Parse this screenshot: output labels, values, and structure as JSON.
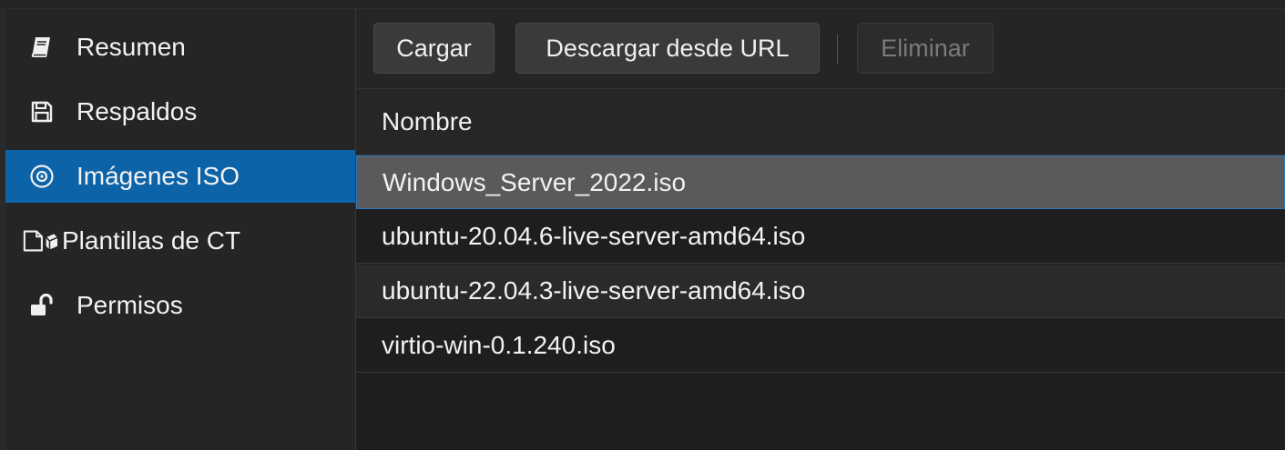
{
  "sidebar": {
    "items": [
      {
        "label": "Resumen",
        "icon": "book-icon",
        "active": false
      },
      {
        "label": "Respaldos",
        "icon": "floppy-disk-icon",
        "active": false
      },
      {
        "label": "Imágenes ISO",
        "icon": "disc-icon",
        "active": true
      },
      {
        "label": "Plantillas de CT",
        "icon": "container-template-icon",
        "active": false
      },
      {
        "label": "Permisos",
        "icon": "unlock-icon",
        "active": false
      }
    ]
  },
  "toolbar": {
    "upload_label": "Cargar",
    "download_url_label": "Descargar desde URL",
    "remove_label": "Eliminar"
  },
  "grid": {
    "columns": [
      "Nombre"
    ],
    "rows": [
      {
        "name": "Windows_Server_2022.iso",
        "selected": true
      },
      {
        "name": "ubuntu-20.04.6-live-server-amd64.iso",
        "selected": false
      },
      {
        "name": "ubuntu-22.04.3-live-server-amd64.iso",
        "selected": false
      },
      {
        "name": "virtio-win-0.1.240.iso",
        "selected": false
      }
    ]
  },
  "colors": {
    "accent": "#0d63a8",
    "selection_border": "#2b78c0",
    "background": "#1e1e1e"
  }
}
